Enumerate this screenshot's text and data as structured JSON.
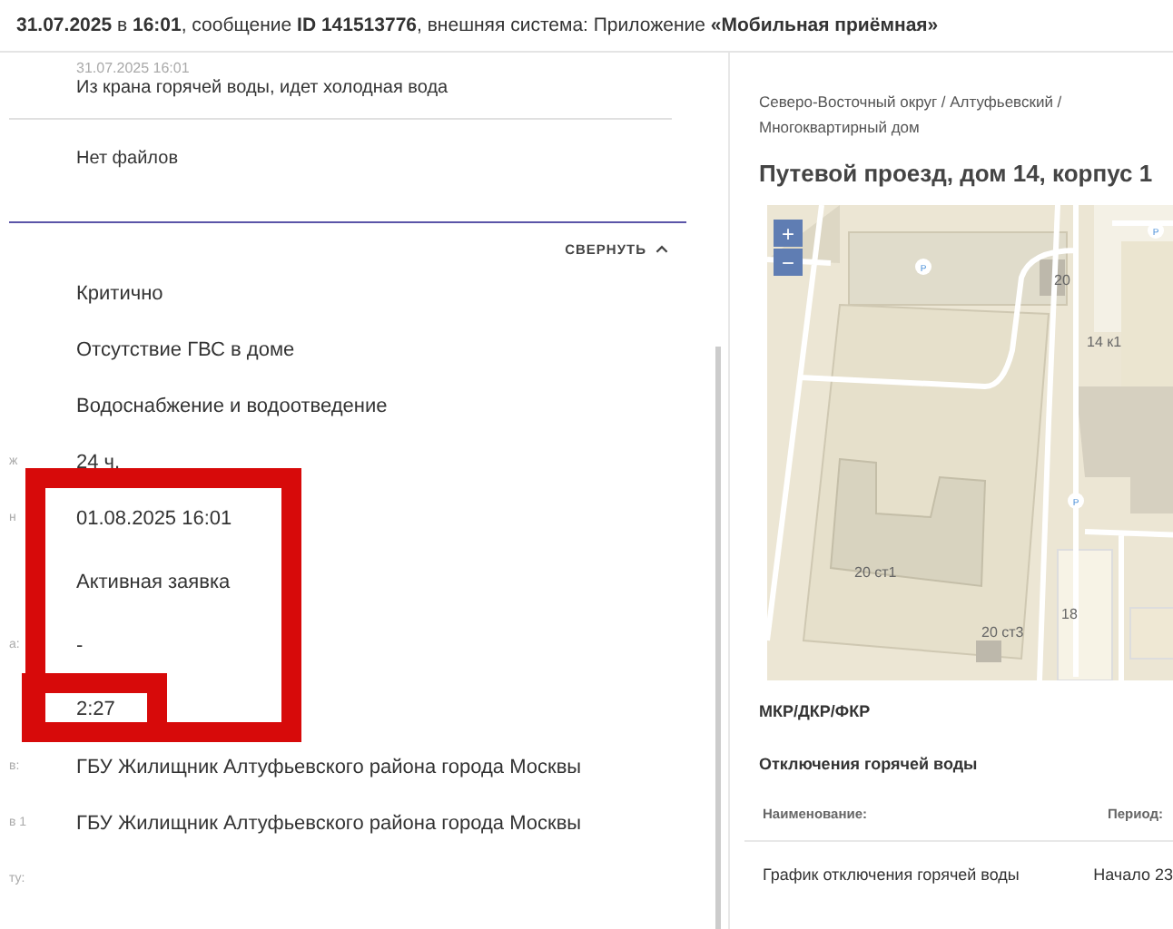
{
  "header": {
    "text": "**31.07.2025** в **16:01**, сообщение **ID 141513776**, внешняя система: Приложение **«Мобильная приёмная»**"
  },
  "message": {
    "date": "31.07.2025 16:01",
    "text": "Из крана горячей воды, идет холодная вода"
  },
  "files": {
    "empty_text": "Нет файлов"
  },
  "collapse": {
    "label": "СВЕРНУТЬ",
    "expanded": true
  },
  "details": [
    {
      "value": "Критично",
      "outlined": false,
      "emphasized": false
    },
    {
      "value": "Отсутствие ГВС в доме",
      "outlined": false,
      "emphasized": false
    },
    {
      "value": "Водоснабжение и водоотведение",
      "outlined": false,
      "emphasized": false
    },
    {
      "label": "ж",
      "value": "24 ч.",
      "outlined": false,
      "emphasized": false
    },
    {
      "label": "н",
      "value": "01.08.2025 16:01",
      "outlined": true,
      "emphasized": false
    },
    {
      "value": "Активная заявка",
      "outlined": true,
      "emphasized": false
    },
    {
      "label": "а:",
      "value": "-",
      "outlined": true,
      "emphasized": false
    },
    {
      "value": "2:27",
      "outlined": true,
      "emphasized": true
    },
    {
      "label": "в:",
      "value": "ГБУ Жилищник Алтуфьевского района города Москвы",
      "outlined": false,
      "emphasized": false
    },
    {
      "label": "в 1",
      "value": "ГБУ Жилищник Алтуфьевского района города Москвы",
      "outlined": false,
      "emphasized": false
    },
    {
      "label": "ту:",
      "outlined": false,
      "emphasized": false
    }
  ],
  "address": {
    "breadcrumb": "Северо-Восточный округ / Алтуфьевский / Многоквартирный дом",
    "title": "Путевой проезд, дом 14, корпус 1"
  },
  "map": {
    "zoom_in": "+",
    "zoom_out": "−",
    "labels": [
      "20",
      "14 к1",
      "20 ст1",
      "18",
      "20 ст3",
      "P",
      "P",
      "P"
    ]
  },
  "repairs": {
    "title": "МКР/ДКР/ФКР"
  },
  "outages": {
    "title": "Отключения горячей воды",
    "columns": [
      "Наименование:",
      "Период:"
    ],
    "rows": [
      [
        "График отключения горячей воды",
        "Начало 23"
      ]
    ]
  }
}
